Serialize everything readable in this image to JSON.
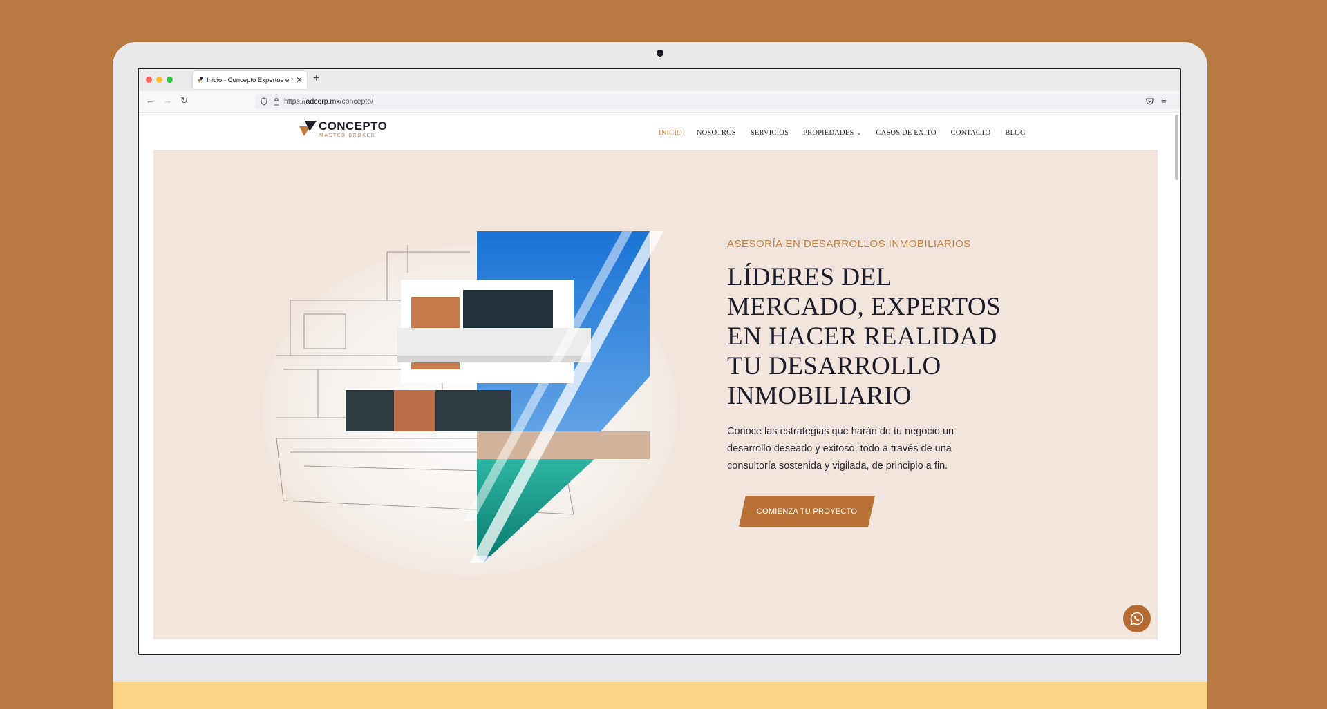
{
  "colors": {
    "background": "#b87a40",
    "accent": "#b87236",
    "hero_bg": "#f1e5dd",
    "text_dark": "#1c1c28"
  },
  "browser": {
    "tab_title": "Inicio - Concepto Expertos en D",
    "tab_close": "✕",
    "new_tab": "+",
    "url_prefix": "https://",
    "url_host": "adcorp.mx",
    "url_path": "/concepto/",
    "icons": [
      "back-icon",
      "forward-icon",
      "reload-icon",
      "shield-icon",
      "lock-icon",
      "star-icon",
      "pocket-icon",
      "menu-icon"
    ]
  },
  "site": {
    "logo_name": "CONCEPTO",
    "logo_tagline": "MASTER BROKER",
    "nav": [
      {
        "label": "INICIO",
        "active": true
      },
      {
        "label": "NOSOTROS"
      },
      {
        "label": "SERVICIOS"
      },
      {
        "label": "PROPIEDADES",
        "dropdown": true
      },
      {
        "label": "CASOS DE EXITO"
      },
      {
        "label": "CONTACTO"
      },
      {
        "label": "BLOG"
      }
    ]
  },
  "hero": {
    "eyebrow": "ASESORÍA EN DESARROLLOS INMOBILIARIOS",
    "headline_lines": [
      "LÍDERES DEL",
      "MERCADO, EXPERTOS",
      "EN HACER REALIDAD",
      "TU DESARROLLO",
      "INMOBILIARIO"
    ],
    "body": "Conoce las estrategias que harán de tu negocio un desarrollo deseado y exitoso, todo a través de una consultoría sostenida y vigilada, de principio a fin.",
    "cta_label": "COMIENZA TU PROYECTO"
  }
}
